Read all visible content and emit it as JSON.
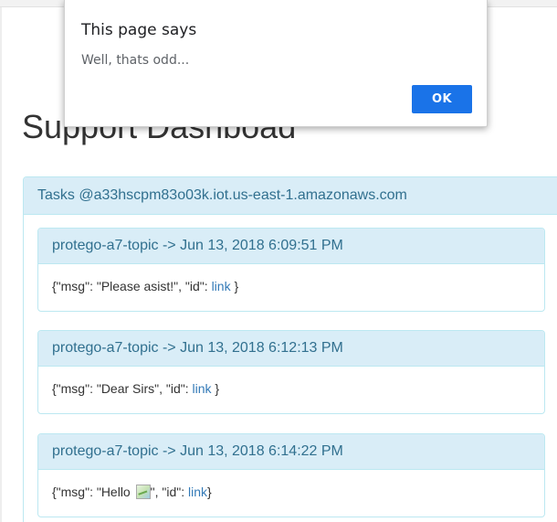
{
  "dialog": {
    "title": "This page says",
    "message": "Well, thats odd...",
    "ok_label": "OK"
  },
  "page": {
    "title": "Support Dashboad"
  },
  "tasks_panel": {
    "heading": "Tasks @a33hscpm83o03k.iot.us-east-1.amazonaws.com",
    "items": [
      {
        "heading": "protego-a7-topic -> Jun 13, 2018 6:09:51 PM",
        "body_prefix": "{\"msg\": \"Please asist!\", \"id\": ",
        "link_label": "link",
        "body_suffix": " }"
      },
      {
        "heading": "protego-a7-topic -> Jun 13, 2018 6:12:13 PM",
        "body_prefix": "{\"msg\": \"Dear Sirs\", \"id\": ",
        "link_label": "link",
        "body_suffix": " }"
      },
      {
        "heading": "protego-a7-topic -> Jun 13, 2018 6:14:22 PM",
        "body_prefix": "{\"msg\": \"Hello ",
        "body_middle": "\", \"id\": ",
        "link_label": "link",
        "body_suffix": "}"
      }
    ]
  },
  "colors": {
    "panel_heading_bg": "#d9edf7",
    "panel_border": "#bce8f1",
    "panel_heading_text": "#31708f",
    "link": "#337ab7",
    "dialog_button": "#1a73e8"
  }
}
